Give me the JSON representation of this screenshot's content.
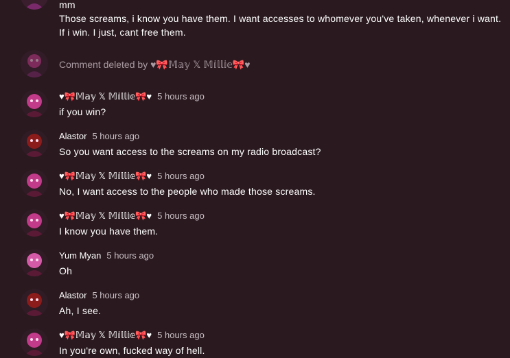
{
  "top_comment": {
    "lines": [
      "mm",
      "Those screams, i know you have them. I want accesses to whomever you've taken, whenever i want.",
      "If i win. I just, cant free them."
    ]
  },
  "deleted_notice": {
    "prefix": "Comment deleted by",
    "author": "♥🎀𝕄𝕒𝕪 𝕏 𝕄𝕚𝕝𝕝𝕚𝕖🎀♥"
  },
  "comments": [
    {
      "author": "♥🎀𝕄𝕒𝕪 𝕏 𝕄𝕚𝕝𝕝𝕚𝕖🎀♥",
      "time": "5 hours ago",
      "text": "if you win?",
      "avatar_color": "#c23a8a"
    },
    {
      "author": "Alastor",
      "time": "5 hours ago",
      "text": "So you want access to the screams on my radio broadcast?",
      "avatar_color": "#8c1c1c"
    },
    {
      "author": "♥🎀𝕄𝕒𝕪 𝕏 𝕄𝕚𝕝𝕝𝕚𝕖🎀♥",
      "time": "5 hours ago",
      "text": "No, I want access to the people who made those screams.",
      "avatar_color": "#c23a8a"
    },
    {
      "author": "♥🎀𝕄𝕒𝕪 𝕏 𝕄𝕚𝕝𝕝𝕚𝕖🎀♥",
      "time": "5 hours ago",
      "text": "I know you have them.",
      "avatar_color": "#c23a8a"
    },
    {
      "author": "Yum Myan",
      "time": "5 hours ago",
      "text": "Oh",
      "avatar_color": "#d45aa8"
    },
    {
      "author": "Alastor",
      "time": "5 hours ago",
      "text": "Ah, I see.",
      "avatar_color": "#8c1c1c"
    },
    {
      "author": "♥🎀𝕄𝕒𝕪 𝕏 𝕄𝕚𝕝𝕝𝕚𝕖🎀♥",
      "time": "5 hours ago",
      "text": "In you're own, fucked way of hell.",
      "avatar_color": "#c23a8a"
    }
  ]
}
